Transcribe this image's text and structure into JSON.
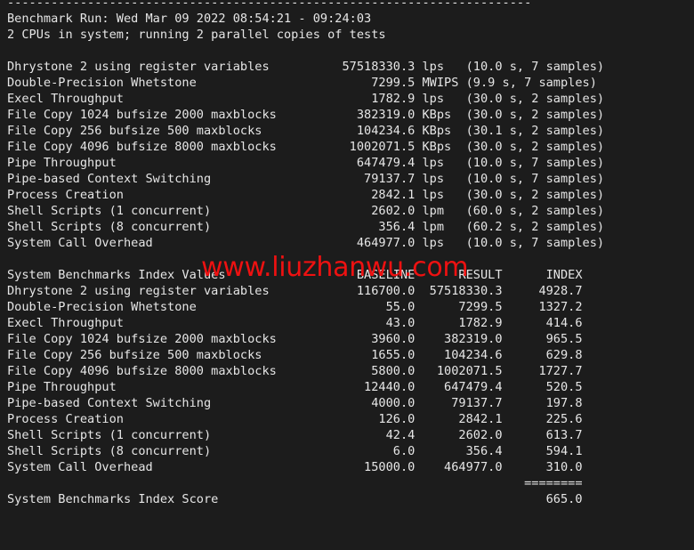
{
  "terminal": {
    "background_color": "#1c1c1c",
    "text_color": "#e6e6e6",
    "watermark_color": "#ee1111",
    "separator_top": "------------------------------------------------------------------------",
    "header": {
      "run_line": "Benchmark Run: Wed Mar 09 2022 08:54:21 - 09:24:03",
      "cpu_line": "2 CPUs in system; running 2 parallel copies of tests"
    },
    "watermark": "www.liuzhanwu.com",
    "results": {
      "rows": [
        {
          "name": "Dhrystone 2 using register variables",
          "value": "57518330.3",
          "unit": "lps",
          "detail": "(10.0 s, 7 samples)"
        },
        {
          "name": "Double-Precision Whetstone",
          "value": "7299.5",
          "unit": "MWIPS",
          "detail": "(9.9 s, 7 samples)"
        },
        {
          "name": "Execl Throughput",
          "value": "1782.9",
          "unit": "lps",
          "detail": "(30.0 s, 2 samples)"
        },
        {
          "name": "File Copy 1024 bufsize 2000 maxblocks",
          "value": "382319.0",
          "unit": "KBps",
          "detail": "(30.0 s, 2 samples)"
        },
        {
          "name": "File Copy 256 bufsize 500 maxblocks",
          "value": "104234.6",
          "unit": "KBps",
          "detail": "(30.1 s, 2 samples)"
        },
        {
          "name": "File Copy 4096 bufsize 8000 maxblocks",
          "value": "1002071.5",
          "unit": "KBps",
          "detail": "(30.0 s, 2 samples)"
        },
        {
          "name": "Pipe Throughput",
          "value": "647479.4",
          "unit": "lps",
          "detail": "(10.0 s, 7 samples)"
        },
        {
          "name": "Pipe-based Context Switching",
          "value": "79137.7",
          "unit": "lps",
          "detail": "(10.0 s, 7 samples)"
        },
        {
          "name": "Process Creation",
          "value": "2842.1",
          "unit": "lps",
          "detail": "(30.0 s, 2 samples)"
        },
        {
          "name": "Shell Scripts (1 concurrent)",
          "value": "2602.0",
          "unit": "lpm",
          "detail": "(60.0 s, 2 samples)"
        },
        {
          "name": "Shell Scripts (8 concurrent)",
          "value": "356.4",
          "unit": "lpm",
          "detail": "(60.2 s, 2 samples)"
        },
        {
          "name": "System Call Overhead",
          "value": "464977.0",
          "unit": "lps",
          "detail": "(10.0 s, 7 samples)"
        }
      ]
    },
    "index_table": {
      "title": "System Benchmarks Index Values",
      "col_baseline": "BASELINE",
      "col_result": "RESULT",
      "col_index": "INDEX",
      "rows": [
        {
          "name": "Dhrystone 2 using register variables",
          "baseline": "116700.0",
          "result": "57518330.3",
          "index": "4928.7"
        },
        {
          "name": "Double-Precision Whetstone",
          "baseline": "55.0",
          "result": "7299.5",
          "index": "1327.2"
        },
        {
          "name": "Execl Throughput",
          "baseline": "43.0",
          "result": "1782.9",
          "index": "414.6"
        },
        {
          "name": "File Copy 1024 bufsize 2000 maxblocks",
          "baseline": "3960.0",
          "result": "382319.0",
          "index": "965.5"
        },
        {
          "name": "File Copy 256 bufsize 500 maxblocks",
          "baseline": "1655.0",
          "result": "104234.6",
          "index": "629.8"
        },
        {
          "name": "File Copy 4096 bufsize 8000 maxblocks",
          "baseline": "5800.0",
          "result": "1002071.5",
          "index": "1727.7"
        },
        {
          "name": "Pipe Throughput",
          "baseline": "12440.0",
          "result": "647479.4",
          "index": "520.5"
        },
        {
          "name": "Pipe-based Context Switching",
          "baseline": "4000.0",
          "result": "79137.7",
          "index": "197.8"
        },
        {
          "name": "Process Creation",
          "baseline": "126.0",
          "result": "2842.1",
          "index": "225.6"
        },
        {
          "name": "Shell Scripts (1 concurrent)",
          "baseline": "42.4",
          "result": "2602.0",
          "index": "613.7"
        },
        {
          "name": "Shell Scripts (8 concurrent)",
          "baseline": "6.0",
          "result": "356.4",
          "index": "594.1"
        },
        {
          "name": "System Call Overhead",
          "baseline": "15000.0",
          "result": "464977.0",
          "index": "310.0"
        }
      ],
      "separator": "========",
      "score_label": "System Benchmarks Index Score",
      "score_value": "665.0"
    }
  }
}
